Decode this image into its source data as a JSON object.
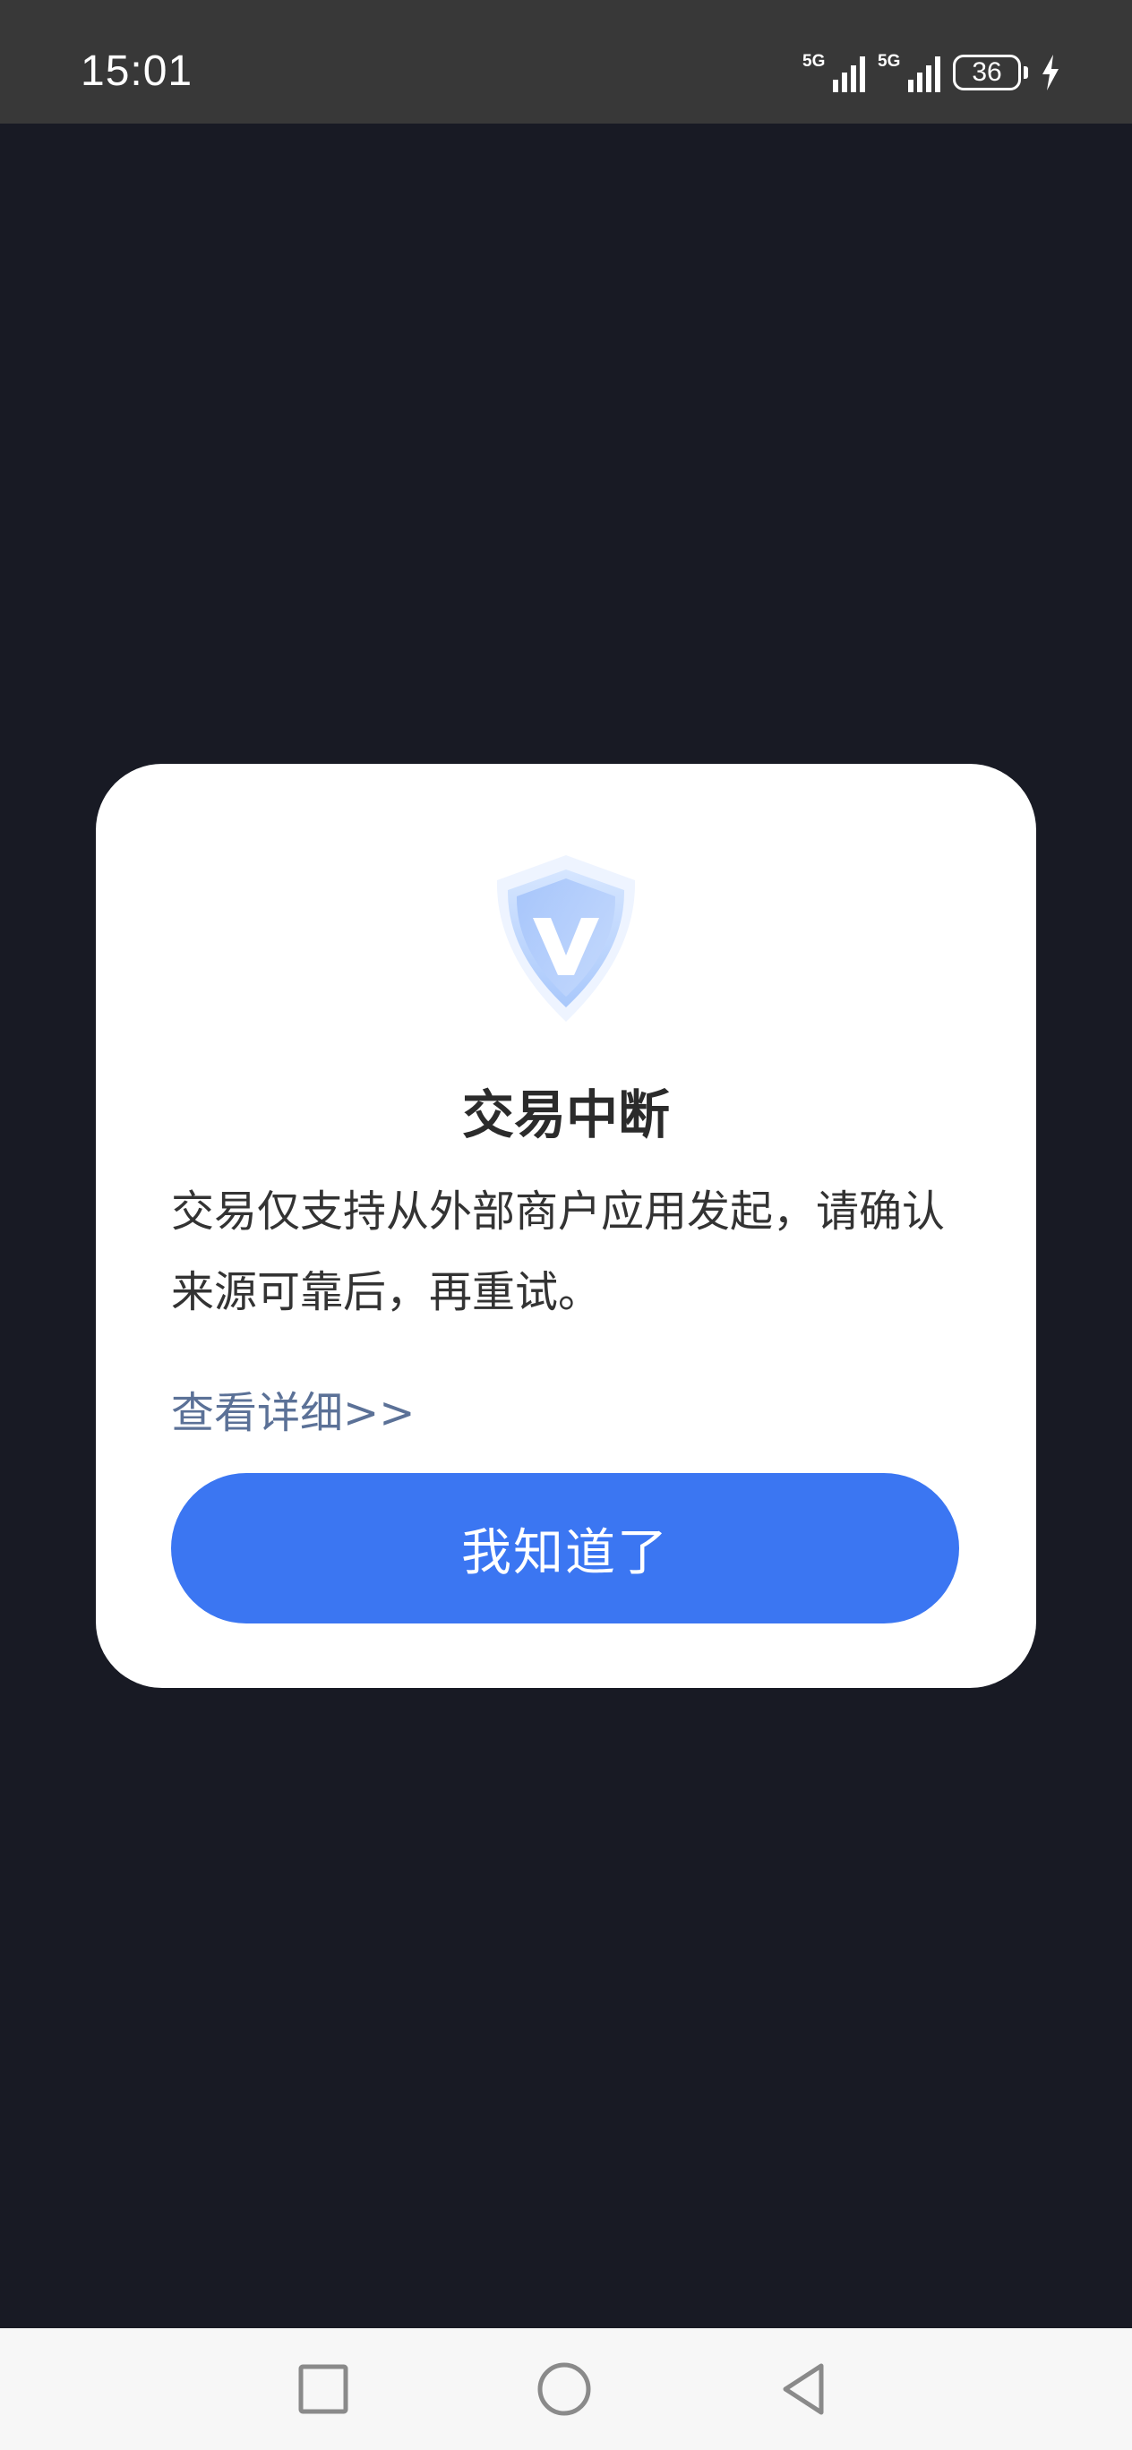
{
  "status_bar": {
    "time": "15:01",
    "network_1": "5G",
    "network_2": "5G",
    "battery_level": "36"
  },
  "dialog": {
    "icon": "shield-v-icon",
    "title": "交易中断",
    "message": "交易仅支持从外部商户应用发起，请确认来源可靠后，再重试。",
    "details_link": "查看详细>>",
    "confirm_button": "我知道了"
  },
  "nav_bar": {
    "recent": "square-icon",
    "home": "circle-icon",
    "back": "triangle-back-icon"
  },
  "colors": {
    "background": "#181a24",
    "status_bar": "#383838",
    "primary_button": "#3b76f2",
    "link": "#5b7197"
  }
}
